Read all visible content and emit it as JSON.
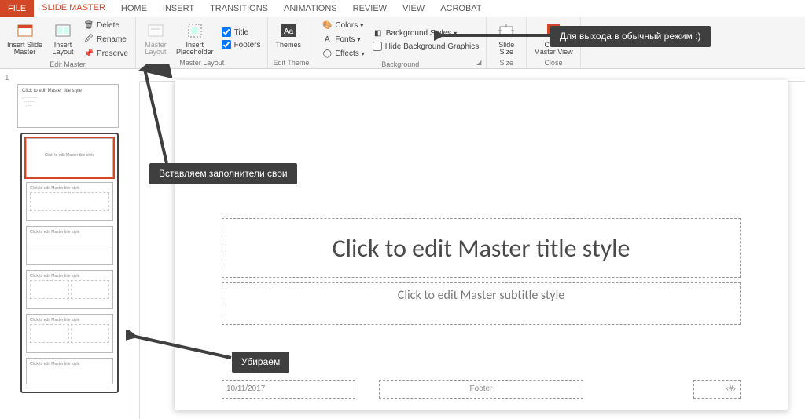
{
  "tabs": {
    "file": "FILE",
    "active": "SLIDE MASTER",
    "items": [
      "HOME",
      "INSERT",
      "TRANSITIONS",
      "ANIMATIONS",
      "REVIEW",
      "VIEW",
      "ACROBAT"
    ]
  },
  "ribbon": {
    "edit_master": {
      "label": "Edit Master",
      "insert_slide": "Insert Slide\nMaster",
      "insert_layout": "Insert\nLayout",
      "delete": "Delete",
      "rename": "Rename",
      "preserve": "Preserve"
    },
    "master_layout": {
      "label": "Master Layout",
      "master_layout_btn": "Master\nLayout",
      "insert_placeholder": "Insert\nPlaceholder",
      "title": "Title",
      "footers": "Footers"
    },
    "edit_theme": {
      "label": "Edit Theme",
      "themes": "Themes"
    },
    "background": {
      "label": "Background",
      "colors": "Colors",
      "fonts": "Fonts",
      "effects": "Effects",
      "bg_styles": "Background Styles",
      "hide_bg": "Hide Background Graphics"
    },
    "size": {
      "label": "Size",
      "slide_size": "Slide\nSize"
    },
    "close": {
      "label": "Close",
      "close_btn": "Close\nMaster View"
    }
  },
  "thumbs": {
    "number": "1",
    "master_text": "Click to edit Master title style"
  },
  "slide": {
    "title": "Click to edit Master title style",
    "subtitle": "Click to edit Master subtitle style",
    "date": "10/11/2017",
    "footer": "Footer",
    "page": "‹#›"
  },
  "callouts": {
    "close": "Для выхода в обычный режим :)",
    "insert": "Вставляем заполнители свои",
    "remove": "Убираем"
  }
}
